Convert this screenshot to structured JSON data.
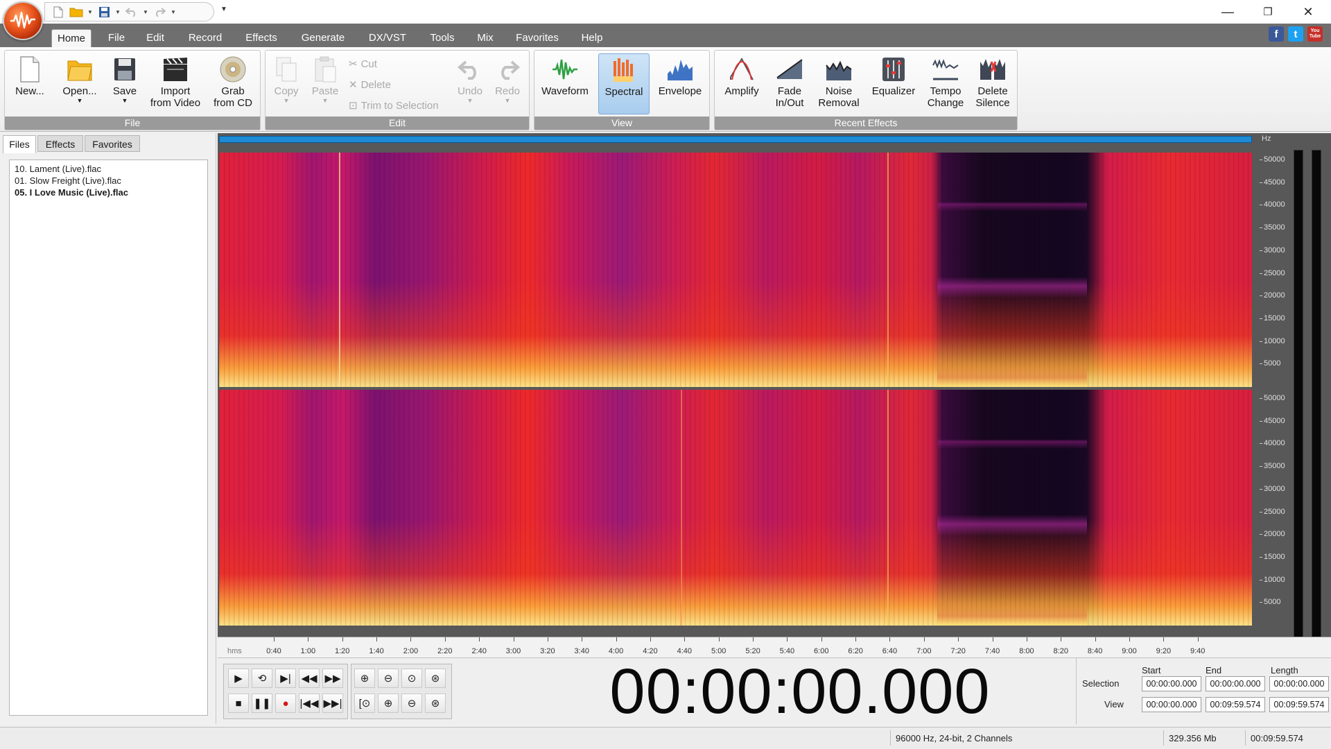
{
  "window": {
    "controls": {
      "minimize": "—",
      "restore": "❐",
      "close": "✕"
    }
  },
  "ribbon_tabs": [
    "Home",
    "File",
    "Edit",
    "Record",
    "Effects",
    "Generate",
    "DX/VST",
    "Tools",
    "Mix",
    "Favorites",
    "Help"
  ],
  "social": {
    "facebook": "f",
    "twitter": "t",
    "youtube": "You Tube"
  },
  "groups": {
    "file": {
      "label": "File",
      "new": "New...",
      "open": "Open...",
      "save": "Save",
      "import_video_1": "Import",
      "import_video_2": "from Video",
      "grab_cd_1": "Grab",
      "grab_cd_2": "from CD"
    },
    "edit": {
      "label": "Edit",
      "copy": "Copy",
      "paste": "Paste",
      "cut": "Cut",
      "delete": "Delete",
      "trim": "Trim to Selection",
      "undo": "Undo",
      "redo": "Redo"
    },
    "view": {
      "label": "View",
      "waveform": "Waveform",
      "spectral": "Spectral",
      "envelope": "Envelope"
    },
    "recent": {
      "label": "Recent Effects",
      "amplify": "Amplify",
      "fade_1": "Fade",
      "fade_2": "In/Out",
      "noise_1": "Noise",
      "noise_2": "Removal",
      "equalizer": "Equalizer",
      "tempo_1": "Tempo",
      "tempo_2": "Change",
      "silence_1": "Delete",
      "silence_2": "Silence"
    }
  },
  "side_tabs": [
    "Files",
    "Effects",
    "Favorites"
  ],
  "files": [
    "10. Lament (Live).flac",
    "01. Slow Freight (Live).flac",
    "05. I Love Music (Live).flac"
  ],
  "active_file_index": 2,
  "spectrum": {
    "unit": "Hz",
    "ticks": [
      "50000",
      "45000",
      "40000",
      "35000",
      "30000",
      "25000",
      "20000",
      "15000",
      "10000",
      "5000"
    ]
  },
  "timeline": {
    "unit": "hms",
    "ticks": [
      "0:40",
      "1:00",
      "1:20",
      "1:40",
      "2:00",
      "2:20",
      "2:40",
      "3:00",
      "3:20",
      "3:40",
      "4:00",
      "4:20",
      "4:40",
      "5:00",
      "5:20",
      "5:40",
      "6:00",
      "6:20",
      "6:40",
      "7:00",
      "7:20",
      "7:40",
      "8:00",
      "8:20",
      "8:40",
      "9:00",
      "9:20",
      "9:40"
    ]
  },
  "position_display": "00:00:00.000",
  "range": {
    "start_label": "Start",
    "end_label": "End",
    "length_label": "Length",
    "selection_label": "Selection",
    "view_label": "View",
    "selection": {
      "start": "00:00:00.000",
      "end": "00:00:00.000",
      "length": "00:00:00.000"
    },
    "view": {
      "start": "00:00:00.000",
      "end": "00:09:59.574",
      "length": "00:09:59.574"
    }
  },
  "status": {
    "format": "96000 Hz, 24-bit, 2 Channels",
    "size": "329.356 Mb",
    "duration": "00:09:59.574"
  },
  "colors": {
    "accent": "#1e8ad4",
    "tab_bar": "#6f6f6f",
    "group_label": "#9a9a9a"
  }
}
